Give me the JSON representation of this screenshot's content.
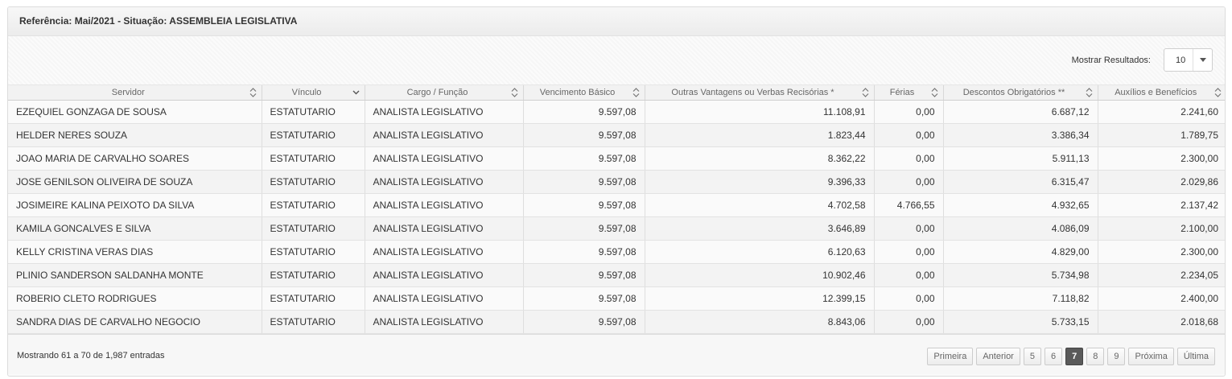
{
  "header": {
    "title": "Referência: Mai/2021 - Situação: ASSEMBLEIA LEGISLATIVA"
  },
  "toolbar": {
    "show_label": "Mostrar Resultados:",
    "page_size": "10"
  },
  "table": {
    "columns": [
      "Servidor",
      "Vínculo",
      "Cargo / Função",
      "Vencimento Básico",
      "Outras Vantagens ou Verbas Recisórias *",
      "Férias",
      "Descontos Obrigatórios **",
      "Auxílios e Benefícios"
    ],
    "rows": [
      [
        "EZEQUIEL GONZAGA DE SOUSA",
        "ESTATUTARIO",
        "ANALISTA LEGISLATIVO",
        "9.597,08",
        "11.108,91",
        "0,00",
        "6.687,12",
        "2.241,60"
      ],
      [
        "HELDER NERES SOUZA",
        "ESTATUTARIO",
        "ANALISTA LEGISLATIVO",
        "9.597,08",
        "1.823,44",
        "0,00",
        "3.386,34",
        "1.789,75"
      ],
      [
        "JOAO MARIA DE CARVALHO SOARES",
        "ESTATUTARIO",
        "ANALISTA LEGISLATIVO",
        "9.597,08",
        "8.362,22",
        "0,00",
        "5.911,13",
        "2.300,00"
      ],
      [
        "JOSE GENILSON OLIVEIRA DE SOUZA",
        "ESTATUTARIO",
        "ANALISTA LEGISLATIVO",
        "9.597,08",
        "9.396,33",
        "0,00",
        "6.315,47",
        "2.029,86"
      ],
      [
        "JOSIMEIRE KALINA PEIXOTO DA SILVA",
        "ESTATUTARIO",
        "ANALISTA LEGISLATIVO",
        "9.597,08",
        "4.702,58",
        "4.766,55",
        "4.932,65",
        "2.137,42"
      ],
      [
        "KAMILA GONCALVES E SILVA",
        "ESTATUTARIO",
        "ANALISTA LEGISLATIVO",
        "9.597,08",
        "3.646,89",
        "0,00",
        "4.086,09",
        "2.100,00"
      ],
      [
        "KELLY CRISTINA VERAS DIAS",
        "ESTATUTARIO",
        "ANALISTA LEGISLATIVO",
        "9.597,08",
        "6.120,63",
        "0,00",
        "4.829,00",
        "2.300,00"
      ],
      [
        "PLINIO SANDERSON SALDANHA MONTE",
        "ESTATUTARIO",
        "ANALISTA LEGISLATIVO",
        "9.597,08",
        "10.902,46",
        "0,00",
        "5.734,98",
        "2.234,05"
      ],
      [
        "ROBERIO CLETO RODRIGUES",
        "ESTATUTARIO",
        "ANALISTA LEGISLATIVO",
        "9.597,08",
        "12.399,15",
        "0,00",
        "7.118,82",
        "2.400,00"
      ],
      [
        "SANDRA DIAS DE CARVALHO NEGOCIO",
        "ESTATUTARIO",
        "ANALISTA LEGISLATIVO",
        "9.597,08",
        "8.843,06",
        "0,00",
        "5.733,15",
        "2.018,68"
      ]
    ]
  },
  "footer": {
    "info": "Mostrando 61 a 70 de 1,987 entradas",
    "first": "Primeira",
    "prev": "Anterior",
    "pages": [
      "5",
      "6",
      "7",
      "8",
      "9"
    ],
    "current_page": "7",
    "next": "Próxima",
    "last": "Última"
  }
}
